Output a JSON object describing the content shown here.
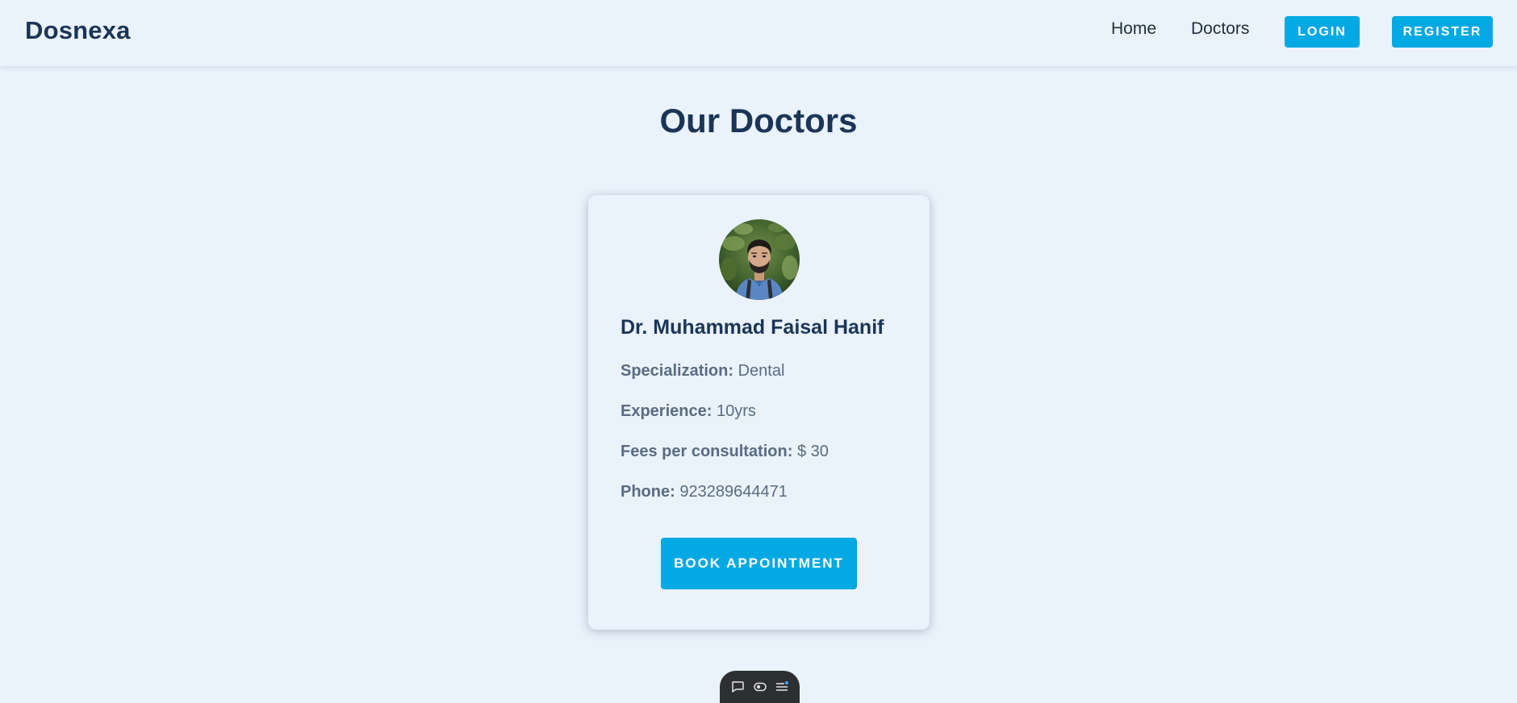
{
  "header": {
    "logo": "Dosnexa",
    "nav": {
      "home": "Home",
      "doctors": "Doctors"
    },
    "login_label": "LOGIN",
    "register_label": "REGISTER"
  },
  "main": {
    "title": "Our Doctors",
    "doctors": [
      {
        "name": "Dr. Muhammad Faisal Hanif",
        "specialization_label": "Specialization:",
        "specialization": "Dental",
        "experience_label": "Experience:",
        "experience": "10yrs",
        "fee_label": "Fees per consultation:",
        "fee": "$ 30",
        "phone_label": "Phone:",
        "phone": "923289644471",
        "book_label": "BOOK APPOINTMENT"
      }
    ]
  },
  "floating_toolbar": {
    "icons": [
      "chat-icon",
      "toggle-view-icon",
      "menu-list-icon"
    ]
  },
  "colors": {
    "background": "#eaf2fb",
    "primary_text": "#1b3557",
    "muted_text": "#5a6b82",
    "accent": "#02a9e3",
    "toolbar_bg": "#2d2f33"
  }
}
